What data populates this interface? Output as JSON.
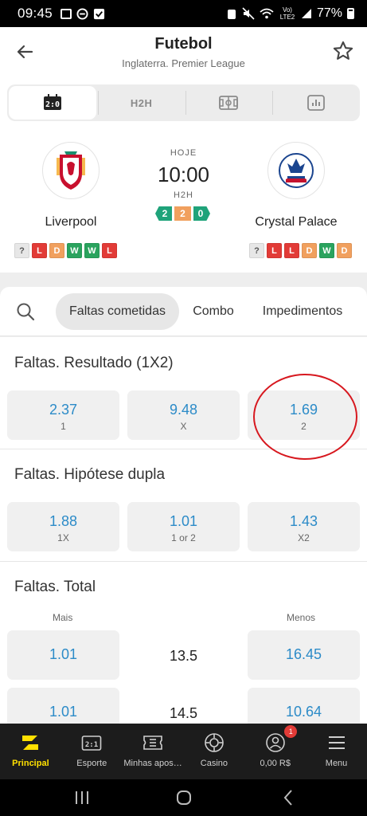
{
  "status_bar": {
    "time": "09:45",
    "network": "Vo) LTE2",
    "battery": "77%"
  },
  "header": {
    "title": "Futebol",
    "subtitle": "Inglaterra. Premier League"
  },
  "tabs": [
    {
      "icon": "scoreboard-icon",
      "label": "2:0"
    },
    {
      "icon": "h2h-icon",
      "label": "H2H"
    },
    {
      "icon": "field-icon",
      "label": ""
    },
    {
      "icon": "stats-icon",
      "label": ""
    }
  ],
  "match": {
    "home": {
      "name": "Liverpool",
      "form": [
        "?",
        "L",
        "D",
        "W",
        "W",
        "L"
      ]
    },
    "away": {
      "name": "Crystal Palace",
      "form": [
        "?",
        "L",
        "L",
        "D",
        "W",
        "D"
      ]
    },
    "day": "HOJE",
    "time": "10:00",
    "h2h_label": "H2H",
    "h2h": {
      "wins": "2",
      "draws": "2",
      "losses": "0"
    }
  },
  "market_filter": {
    "chips": [
      "Faltas cometidas",
      "Combo",
      "Impedimentos"
    ],
    "active_index": 0
  },
  "markets": {
    "result": {
      "title": "Faltas. Resultado (1X2)",
      "odds": [
        {
          "value": "2.37",
          "label": "1"
        },
        {
          "value": "9.48",
          "label": "X"
        },
        {
          "value": "1.69",
          "label": "2"
        }
      ]
    },
    "double": {
      "title": "Faltas. Hipótese dupla",
      "odds": [
        {
          "value": "1.88",
          "label": "1X"
        },
        {
          "value": "1.01",
          "label": "1 or 2"
        },
        {
          "value": "1.43",
          "label": "X2"
        }
      ]
    },
    "total": {
      "title": "Faltas. Total",
      "over_label": "Mais",
      "under_label": "Menos",
      "lines": [
        {
          "over": "1.01",
          "line": "13.5",
          "under": "16.45"
        },
        {
          "over": "1.01",
          "line": "14.5",
          "under": "10.64"
        }
      ]
    }
  },
  "bottom_nav": {
    "items": [
      {
        "label": "Principal",
        "icon": "home-logo-icon"
      },
      {
        "label": "Esporte",
        "icon": "scoreboard-icon",
        "icon_text": "2:1"
      },
      {
        "label": "Minhas apos…",
        "icon": "ticket-icon"
      },
      {
        "label": "Casino",
        "icon": "chip-icon"
      },
      {
        "label": "0,00 R$",
        "icon": "account-icon",
        "badge": "1"
      },
      {
        "label": "Menu",
        "icon": "hamburger-icon"
      }
    ],
    "active_index": 0
  },
  "colors": {
    "accent_blue": "#2c8bc8",
    "nav_active": "#ffe000",
    "win": "#2aa35e",
    "loss": "#e23b37",
    "draw": "#f1a05e",
    "annotation": "#d7181f"
  }
}
